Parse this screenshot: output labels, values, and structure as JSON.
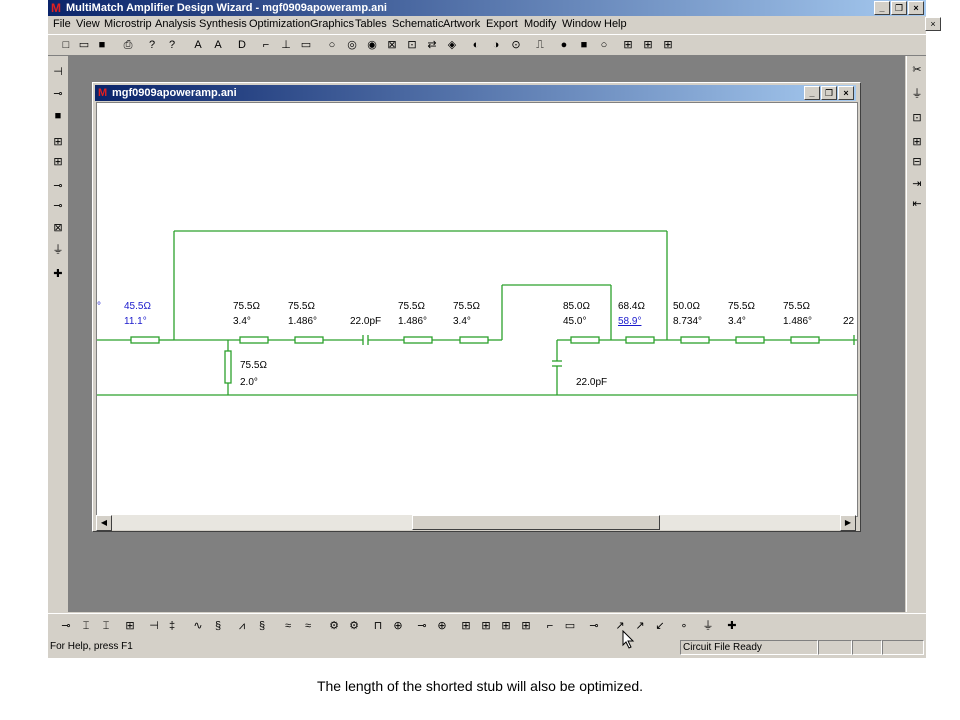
{
  "app": {
    "title": "MultiMatch Amplifier Design Wizard - mgf0909apoweramp.ani",
    "window_buttons": {
      "minimize": "_",
      "restore": "❐",
      "close": "×"
    }
  },
  "menu": [
    "File",
    "View",
    "Microstrip",
    "Analysis",
    "Synthesis",
    "Optimization",
    "Graphics",
    "Tables",
    "Schematic",
    "Artwork",
    "Export",
    "Modify",
    "Window",
    "Help"
  ],
  "child_window": {
    "title": "mgf0909apoweramp.ani",
    "buttons": {
      "minimize": "_",
      "restore": "❐",
      "close": "×"
    }
  },
  "schematic": {
    "elements": [
      {
        "z": "45.5Ω",
        "len": "11.1°",
        "color": "blue"
      },
      {
        "z": "75.5Ω",
        "len": "3.4°"
      },
      {
        "z": "75.5Ω",
        "len": "1.486°"
      },
      {
        "cap": "22.0pF"
      },
      {
        "z": "75.5Ω",
        "len": "1.486°"
      },
      {
        "z": "75.5Ω",
        "len": "3.4°"
      },
      {
        "z": "85.0Ω",
        "len": "45.0°"
      },
      {
        "z": "68.4Ω",
        "len": "58.9°",
        "color": "blue"
      },
      {
        "z": "50.0Ω",
        "len": "8.734°"
      },
      {
        "z": "75.5Ω",
        "len": "3.4°"
      },
      {
        "z": "75.5Ω",
        "len": "1.486°"
      }
    ],
    "partial_right": "22",
    "partial_left": "°",
    "stub": {
      "z": "75.5Ω",
      "len": "2.0°"
    },
    "shunt_cap": "22.0pF"
  },
  "status": {
    "help": "For Help, press F1",
    "panel": "Circuit File Ready"
  },
  "caption": "The length of the shorted stub will also be optimized.",
  "colors": {
    "wire": "#2ca02c",
    "title_blue": "#0a246a",
    "label_blue": "#1a1acc"
  }
}
